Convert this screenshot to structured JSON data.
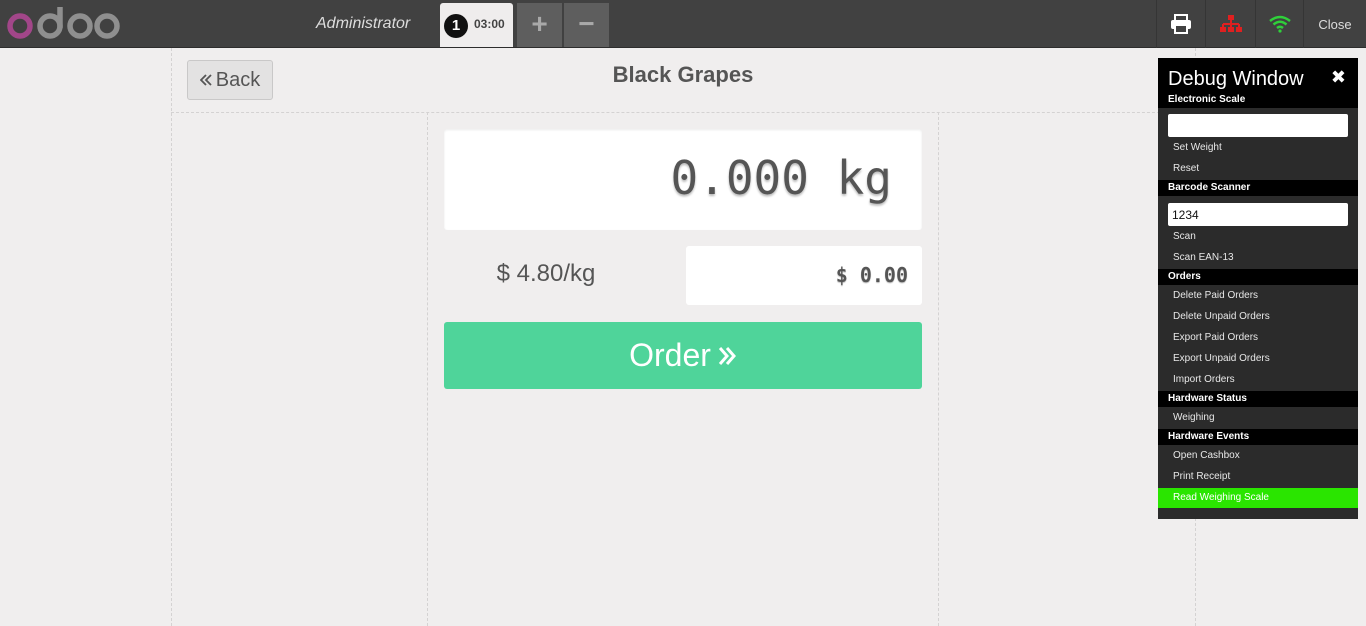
{
  "header": {
    "cashier": "Administrator",
    "order_tab": {
      "number": "1",
      "time": "03:00"
    },
    "add_symbol": "+",
    "remove_symbol": "−",
    "close_label": "Close",
    "icons": [
      "printer-icon",
      "proxy-network-icon",
      "wifi-icon"
    ],
    "colors": {
      "logo_o": "#a24689",
      "logo_doo": "#8f8f8f",
      "proxy": "#e02020",
      "wifi": "#2fd03a"
    }
  },
  "scale": {
    "back_label": "Back",
    "product_name": "Black Grapes",
    "weight": "0.000 kg",
    "price_per_kg": "$ 4.80/kg",
    "total": "$ 0.00",
    "order_label": "Order"
  },
  "debug": {
    "title": "Debug Window",
    "electronic_scale": {
      "title": "Electronic Scale",
      "input_value": "",
      "set_weight": "Set Weight",
      "reset": "Reset"
    },
    "barcode_scanner": {
      "title": "Barcode Scanner",
      "input_value": "1234",
      "scan": "Scan",
      "scan_ean": "Scan EAN-13"
    },
    "orders": {
      "title": "Orders",
      "items": [
        "Delete Paid Orders",
        "Delete Unpaid Orders",
        "Export Paid Orders",
        "Export Unpaid Orders",
        "Import Orders"
      ]
    },
    "hardware_status": {
      "title": "Hardware Status",
      "items": [
        "Weighing"
      ]
    },
    "hardware_events": {
      "title": "Hardware Events",
      "items": [
        "Open Cashbox",
        "Print Receipt",
        "Read Weighing Scale"
      ],
      "active_item": "Read Weighing Scale",
      "active_color": "#2ae500"
    }
  }
}
